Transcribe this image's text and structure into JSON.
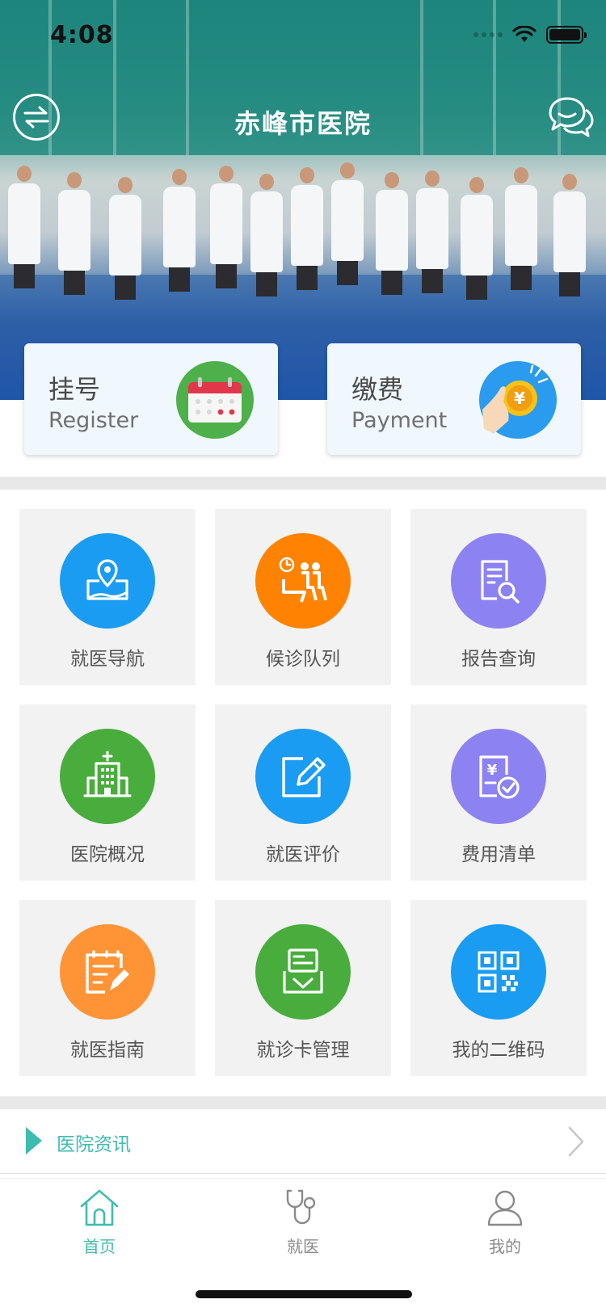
{
  "status_bar": {
    "time": "4:08"
  },
  "nav": {
    "title": "赤峰市医院",
    "switch_icon": "switch-arrows-icon",
    "chat_icon": "chat-bubbles-icon"
  },
  "quick_cards": [
    {
      "cn": "挂号",
      "en": "Register",
      "icon": "calendar-icon",
      "color": "#4db04a"
    },
    {
      "cn": "缴费",
      "en": "Payment",
      "icon": "coin-hand-icon",
      "color": "#2a9bee"
    }
  ],
  "services": [
    {
      "label": "就医导航",
      "icon": "map-pin-icon",
      "color": "#1a9cf2"
    },
    {
      "label": "候诊队列",
      "icon": "waiting-seat-icon",
      "color": "#ff8200"
    },
    {
      "label": "报告查询",
      "icon": "report-search-icon",
      "color": "#8d82f2"
    },
    {
      "label": "医院概况",
      "icon": "hospital-building-icon",
      "color": "#48ad3c"
    },
    {
      "label": "就医评价",
      "icon": "edit-pencil-icon",
      "color": "#1a9cf2"
    },
    {
      "label": "费用清单",
      "icon": "bill-check-icon",
      "color": "#8d82f2"
    },
    {
      "label": "就医指南",
      "icon": "guide-clipboard-icon",
      "color": "#ff9436"
    },
    {
      "label": "就诊卡管理",
      "icon": "card-tray-icon",
      "color": "#48ad3c"
    },
    {
      "label": "我的二维码",
      "icon": "qr-code-icon",
      "color": "#1a9cf2"
    }
  ],
  "news": {
    "title": "医院资讯"
  },
  "tabs": [
    {
      "label": "首页",
      "icon": "home-icon",
      "active": true
    },
    {
      "label": "就医",
      "icon": "stethoscope-icon",
      "active": false
    },
    {
      "label": "我的",
      "icon": "user-icon",
      "active": false
    }
  ],
  "colors": {
    "accent": "#3fbcb0",
    "inactive": "#8a8a8a"
  }
}
